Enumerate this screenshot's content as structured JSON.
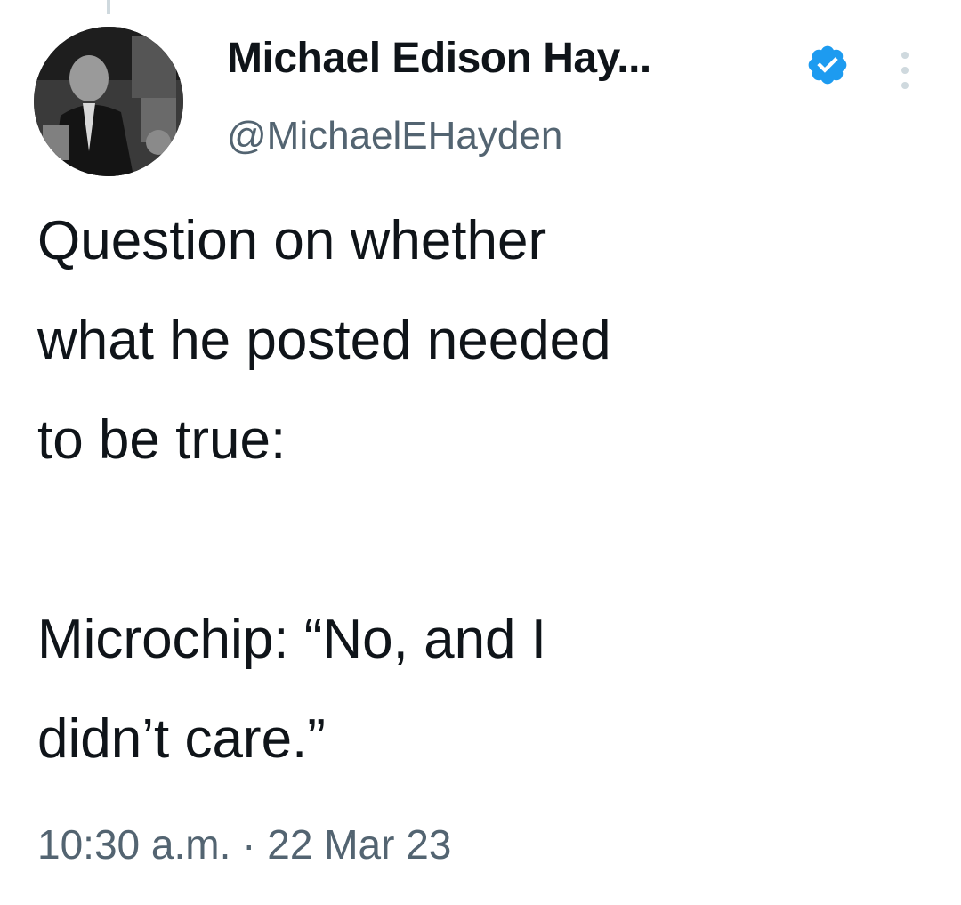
{
  "author": {
    "display_name": "Michael Edison Hay...",
    "handle": "@MichaelEHayden",
    "verified": true,
    "verified_color": "#1d9bf0"
  },
  "tweet": {
    "paragraph_1": "Question on whether\nwhat he posted needed\nto be true:",
    "paragraph_2": "Microchip: “No, and I\ndidn’t care.”",
    "time": "10:30 a.m.",
    "separator": "·",
    "date": "22 Mar 23"
  },
  "icons": {
    "avatar": "profile-photo",
    "verified": "verified-badge-icon",
    "more": "more-vertical-icon"
  }
}
